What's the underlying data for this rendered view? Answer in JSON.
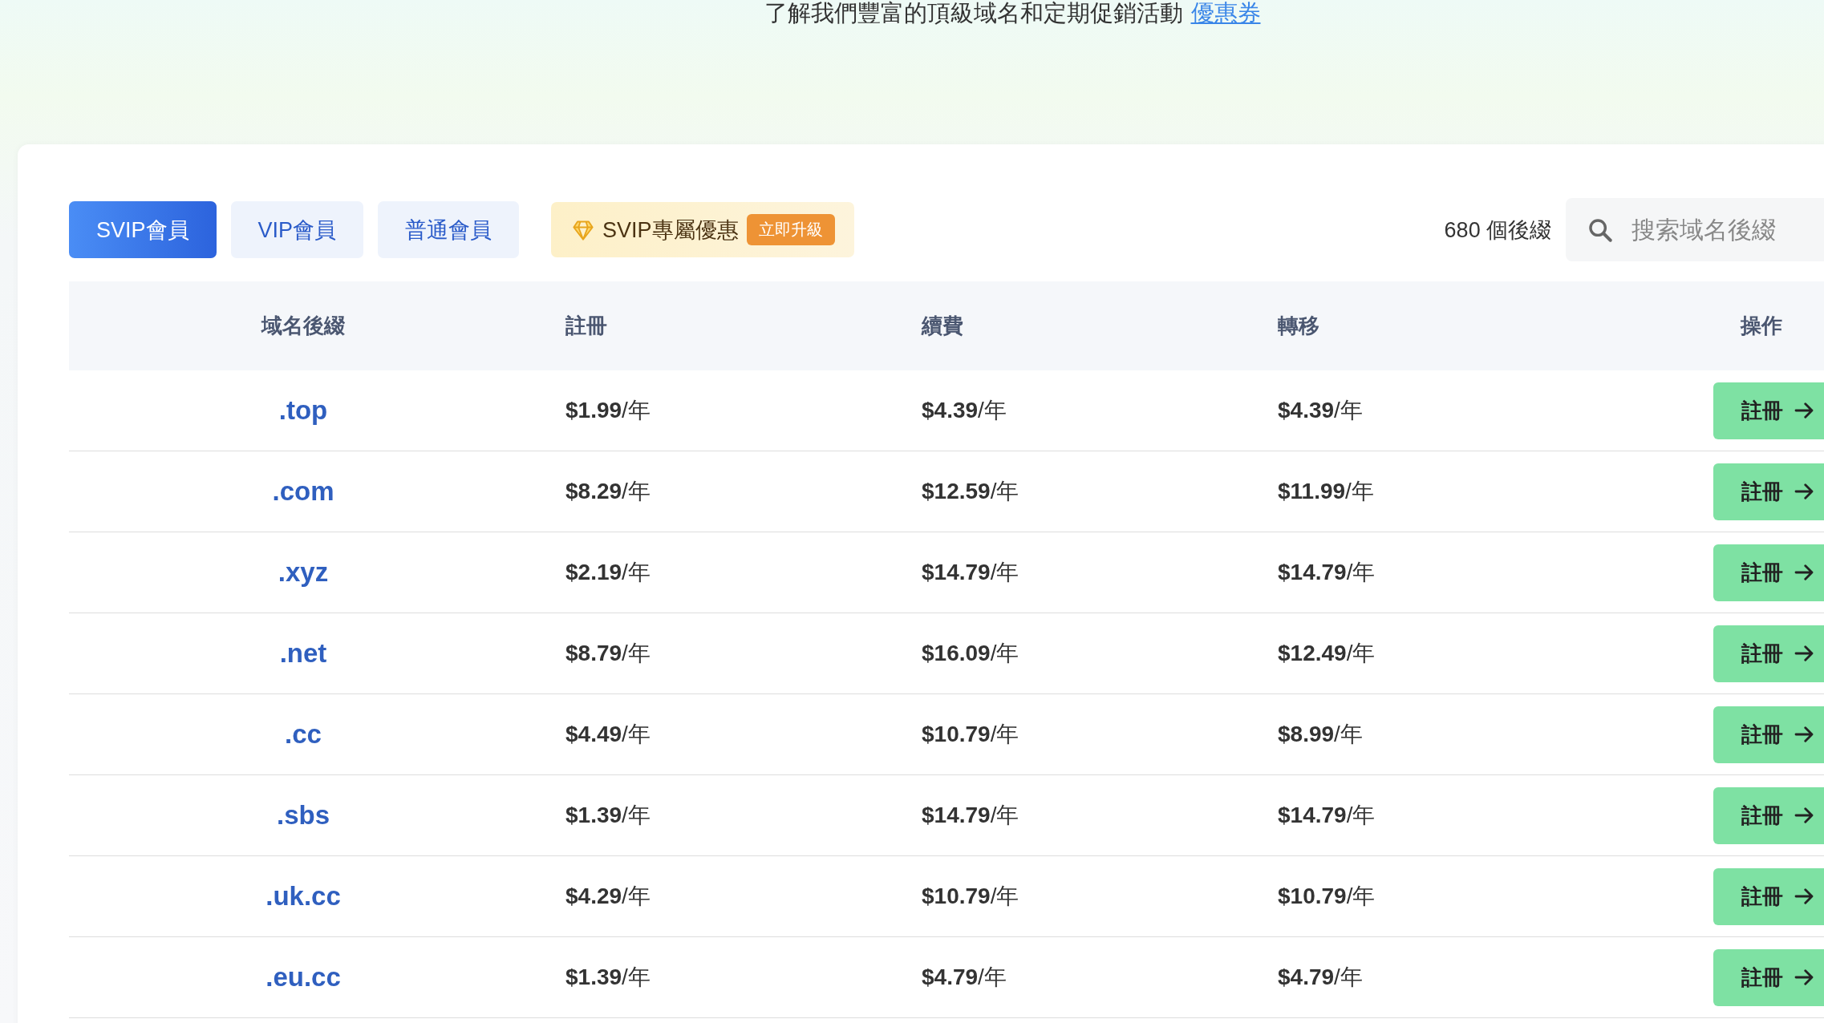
{
  "intro": {
    "text": "了解我們豐富的頂級域名和定期促銷活動",
    "link": "優惠券"
  },
  "tabs": [
    {
      "label": "SVIP會員",
      "selected": true
    },
    {
      "label": "VIP會員",
      "selected": false
    },
    {
      "label": "普通會員",
      "selected": false
    }
  ],
  "promo": {
    "label": "SVIP專屬優惠",
    "badge": "立即升級"
  },
  "count": "680 個後綴",
  "search": {
    "placeholder": "搜索域名後綴"
  },
  "table": {
    "columns": [
      "域名後綴",
      "註冊",
      "續費",
      "轉移",
      "操作"
    ],
    "rows": [
      {
        "domain": ".top",
        "register": "**$1.99**/年",
        "renew": "**$4.39**/年",
        "transfer": "**$4.39**/年",
        "action": "註冊"
      },
      {
        "domain": ".com",
        "register": "**$8.29**/年",
        "renew": "**$12.59**/年",
        "transfer": "**$11.99**/年",
        "action": "註冊"
      },
      {
        "domain": ".xyz",
        "register": "**$2.19**/年",
        "renew": "**$14.79**/年",
        "transfer": "**$14.79**/年",
        "action": "註冊"
      },
      {
        "domain": ".net",
        "register": "**$8.79**/年",
        "renew": "**$16.09**/年",
        "transfer": "**$12.49**/年",
        "action": "註冊"
      },
      {
        "domain": ".cc",
        "register": "**$4.49**/年",
        "renew": "**$10.79**/年",
        "transfer": "**$8.99**/年",
        "action": "註冊"
      },
      {
        "domain": ".sbs",
        "register": "**$1.39**/年",
        "renew": "**$14.79**/年",
        "transfer": "**$14.79**/年",
        "action": "註冊"
      },
      {
        "domain": ".uk.cc",
        "register": "**$4.29**/年",
        "renew": "**$10.79**/年",
        "transfer": "**$10.79**/年",
        "action": "註冊"
      },
      {
        "domain": ".eu.cc",
        "register": "**$1.39**/年",
        "renew": "**$4.79**/年",
        "transfer": "**$4.79**/年",
        "action": "註冊"
      }
    ]
  }
}
